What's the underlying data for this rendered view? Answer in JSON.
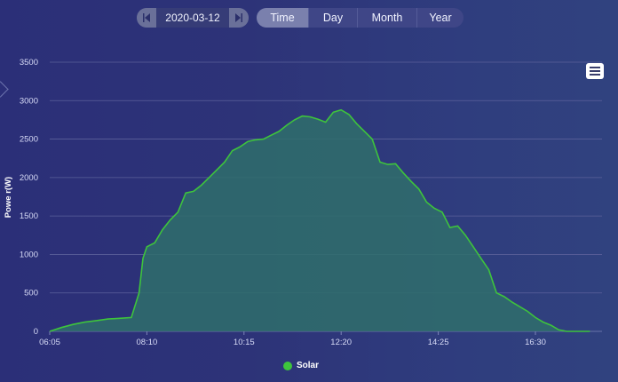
{
  "date_picker": {
    "value": "2020-03-12",
    "prev_icon": "skip-back-icon",
    "next_icon": "skip-forward-icon"
  },
  "tabs": [
    {
      "label": "Time",
      "active": true
    },
    {
      "label": "Day",
      "active": false
    },
    {
      "label": "Month",
      "active": false
    },
    {
      "label": "Year",
      "active": false
    }
  ],
  "menu_icon": "hamburger-menu-icon",
  "colors": {
    "series": "#3ec43c",
    "fill": "#2f6e6b",
    "background": "#2d3378"
  },
  "chart_data": {
    "type": "area",
    "ylabel": "Powe r(W)",
    "xlabel": "",
    "ylim": [
      0,
      3500
    ],
    "yticks": [
      0,
      500,
      1000,
      1500,
      2000,
      2500,
      3000,
      3500
    ],
    "xticks": [
      "06:05",
      "08:10",
      "10:15",
      "12:20",
      "14:25",
      "16:30"
    ],
    "grid": true,
    "legend": "bottom-center",
    "series": [
      {
        "name": "Solar",
        "x": [
          "06:05",
          "06:20",
          "06:35",
          "06:50",
          "07:05",
          "07:20",
          "07:35",
          "07:50",
          "08:00",
          "08:05",
          "08:10",
          "08:20",
          "08:30",
          "08:40",
          "08:50",
          "09:00",
          "09:10",
          "09:20",
          "09:30",
          "09:40",
          "09:50",
          "10:00",
          "10:10",
          "10:20",
          "10:30",
          "10:40",
          "10:50",
          "11:00",
          "11:10",
          "11:20",
          "11:30",
          "11:40",
          "11:50",
          "12:00",
          "12:10",
          "12:20",
          "12:30",
          "12:40",
          "12:50",
          "13:00",
          "13:10",
          "13:20",
          "13:30",
          "13:40",
          "13:50",
          "14:00",
          "14:10",
          "14:20",
          "14:30",
          "14:40",
          "14:50",
          "15:00",
          "15:10",
          "15:20",
          "15:30",
          "15:40",
          "15:50",
          "16:00",
          "16:10",
          "16:20",
          "16:30",
          "16:40",
          "16:50",
          "17:00",
          "17:10",
          "17:20",
          "17:30",
          "17:40"
        ],
        "values": [
          0,
          50,
          90,
          120,
          140,
          160,
          170,
          180,
          500,
          950,
          1100,
          1150,
          1320,
          1450,
          1550,
          1800,
          1820,
          1900,
          2000,
          2100,
          2200,
          2350,
          2400,
          2470,
          2490,
          2500,
          2550,
          2600,
          2680,
          2750,
          2800,
          2790,
          2760,
          2720,
          2850,
          2880,
          2820,
          2700,
          2600,
          2500,
          2200,
          2170,
          2180,
          2060,
          1950,
          1850,
          1680,
          1600,
          1550,
          1350,
          1370,
          1250,
          1100,
          950,
          800,
          500,
          450,
          380,
          320,
          260,
          180,
          120,
          80,
          20,
          0,
          0,
          0,
          0
        ]
      }
    ]
  },
  "legend": {
    "label": "Solar"
  }
}
